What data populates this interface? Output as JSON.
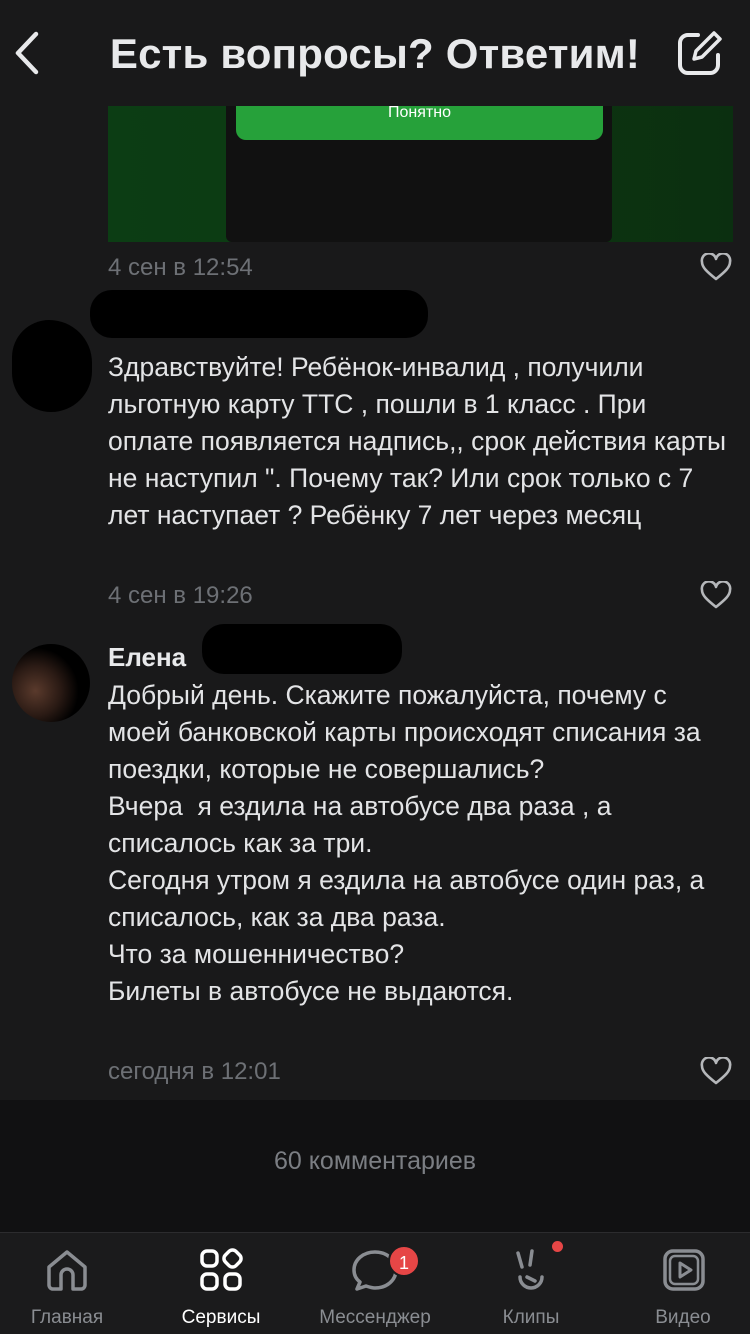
{
  "header": {
    "title": "Есть вопросы? Ответим!"
  },
  "attachment": {
    "button_label": "Понятно"
  },
  "comments": [
    {
      "timestamp": "4 сен в 12:54"
    },
    {
      "author": "",
      "text": "Здравствуйте! Ребёнок-инвалид , получили льготную карту ТТС , пошли в 1 класс . При оплате появляется надпись,, срок действия карты не наступил \". Почему так? Или срок только с 7 лет наступает ? Ребёнку 7 лет через месяц",
      "timestamp": "4 сен в 19:26"
    },
    {
      "author": "Елена",
      "text": "Добрый день. Скажите пожалуйста, почему с моей банковской карты происходят списания за поездки, которые не совершались?\nВчера  я ездила на автобусе два раза , а списалось как за три.\nСегодня утром я ездила на автобусе один раз, а списалось, как за два раза.\nЧто за мошенничество?\nБилеты в автобусе не выдаются.",
      "timestamp": "сегодня в 12:01"
    }
  ],
  "footer": {
    "comments_count": "60 комментариев"
  },
  "tabbar": {
    "items": [
      {
        "label": "Главная",
        "icon": "home-icon"
      },
      {
        "label": "Сервисы",
        "icon": "services-icon",
        "active": true
      },
      {
        "label": "Мессенджер",
        "icon": "messenger-icon",
        "badge": "1"
      },
      {
        "label": "Клипы",
        "icon": "clips-icon"
      },
      {
        "label": "Видео",
        "icon": "video-icon"
      }
    ]
  },
  "colors": {
    "background": "#19191a",
    "badge": "#e64646",
    "accent_green": "#26a13a"
  }
}
